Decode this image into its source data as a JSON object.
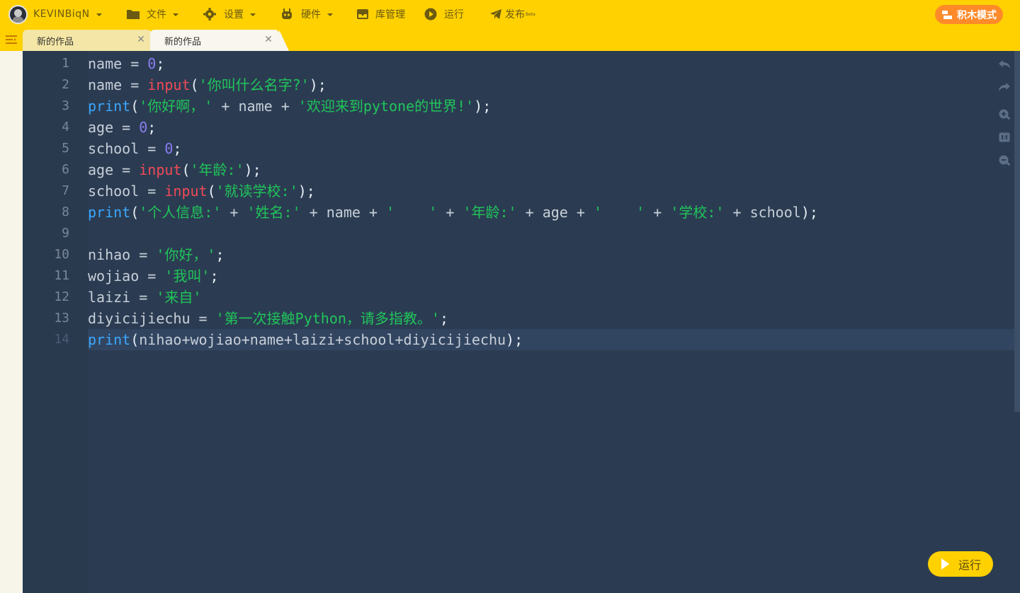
{
  "topbar": {
    "username": "KEVINBiqN",
    "file": "文件",
    "settings": "设置",
    "hardware": "硬件",
    "library": "库管理",
    "run": "运行",
    "publish": "发布",
    "publish_badge": "Beta",
    "mode_button": "积木模式"
  },
  "tabs": [
    {
      "label": "新的作品"
    },
    {
      "label": "新的作品"
    }
  ],
  "editor": {
    "line_numbers": [
      "1",
      "2",
      "3",
      "4",
      "5",
      "6",
      "7",
      "8",
      "9",
      "10",
      "11",
      "12",
      "13",
      "14"
    ],
    "active_line": 14,
    "lines": [
      [
        [
          "var",
          "name"
        ],
        [
          "op",
          " = "
        ],
        [
          "num",
          "0"
        ],
        [
          "pun",
          ";"
        ]
      ],
      [
        [
          "var",
          "name"
        ],
        [
          "op",
          " = "
        ],
        [
          "kw",
          "input"
        ],
        [
          "pun",
          "("
        ],
        [
          "str",
          "'你叫什么名字?'"
        ],
        [
          "pun",
          ");"
        ]
      ],
      [
        [
          "fn",
          "print"
        ],
        [
          "pun",
          "("
        ],
        [
          "str",
          "'你好啊，'"
        ],
        [
          "op",
          " + "
        ],
        [
          "var",
          "name"
        ],
        [
          "op",
          " + "
        ],
        [
          "str",
          "'欢迎来到pytone的世界!'"
        ],
        [
          "pun",
          ");"
        ]
      ],
      [
        [
          "var",
          "age"
        ],
        [
          "op",
          " = "
        ],
        [
          "num",
          "0"
        ],
        [
          "pun",
          ";"
        ]
      ],
      [
        [
          "var",
          "school"
        ],
        [
          "op",
          " = "
        ],
        [
          "num",
          "0"
        ],
        [
          "pun",
          ";"
        ]
      ],
      [
        [
          "var",
          "age"
        ],
        [
          "op",
          " = "
        ],
        [
          "kw",
          "input"
        ],
        [
          "pun",
          "("
        ],
        [
          "str",
          "'年龄:'"
        ],
        [
          "pun",
          ");"
        ]
      ],
      [
        [
          "var",
          "school"
        ],
        [
          "op",
          " = "
        ],
        [
          "kw",
          "input"
        ],
        [
          "pun",
          "("
        ],
        [
          "str",
          "'就读学校:'"
        ],
        [
          "pun",
          ");"
        ]
      ],
      [
        [
          "fn",
          "print"
        ],
        [
          "pun",
          "("
        ],
        [
          "str",
          "'个人信息:'"
        ],
        [
          "op",
          " + "
        ],
        [
          "str",
          "'姓名:'"
        ],
        [
          "op",
          " + "
        ],
        [
          "var",
          "name"
        ],
        [
          "op",
          " + "
        ],
        [
          "str",
          "'    '"
        ],
        [
          "op",
          " + "
        ],
        [
          "str",
          "'年龄:'"
        ],
        [
          "op",
          " + "
        ],
        [
          "var",
          "age"
        ],
        [
          "op",
          " + "
        ],
        [
          "str",
          "'    '"
        ],
        [
          "op",
          " + "
        ],
        [
          "str",
          "'学校:'"
        ],
        [
          "op",
          " + "
        ],
        [
          "var",
          "school"
        ],
        [
          "pun",
          ");"
        ]
      ],
      [],
      [
        [
          "var",
          "nihao"
        ],
        [
          "op",
          " = "
        ],
        [
          "str",
          "'你好，'"
        ],
        [
          "pun",
          ";"
        ]
      ],
      [
        [
          "var",
          "wojiao"
        ],
        [
          "op",
          " = "
        ],
        [
          "str",
          "'我叫'"
        ],
        [
          "pun",
          ";"
        ]
      ],
      [
        [
          "var",
          "laizi"
        ],
        [
          "op",
          " = "
        ],
        [
          "str",
          "'来自'"
        ]
      ],
      [
        [
          "var",
          "diyicijiechu"
        ],
        [
          "op",
          " = "
        ],
        [
          "str",
          "'第一次接触Python，请多指教。'"
        ],
        [
          "pun",
          ";"
        ]
      ],
      [
        [
          "fn",
          "print"
        ],
        [
          "pun",
          "("
        ],
        [
          "var",
          "nihao+wojiao+name+laizi+school+diyicijiechu"
        ],
        [
          "pun",
          ");"
        ]
      ]
    ]
  },
  "run_button": "运行",
  "colors": {
    "topbar": "#ffd100",
    "editor_bg": "#2b3c52",
    "keyword": "#f04a57",
    "function": "#3ba7ff",
    "string": "#20c55a",
    "number": "#8a7cf0",
    "mode_button": "#ff8a2a"
  },
  "icons": {
    "file": "folder-icon",
    "settings": "gear-icon",
    "hardware": "robot-icon",
    "library": "inbox-icon",
    "run": "play-circle-icon",
    "publish": "paper-plane-icon",
    "mode": "blocks-icon",
    "undo": "undo-icon",
    "redo": "redo-icon",
    "zoom_in": "zoom-in-icon",
    "reset_zoom": "zoom-reset-icon",
    "zoom_out": "zoom-out-icon"
  }
}
